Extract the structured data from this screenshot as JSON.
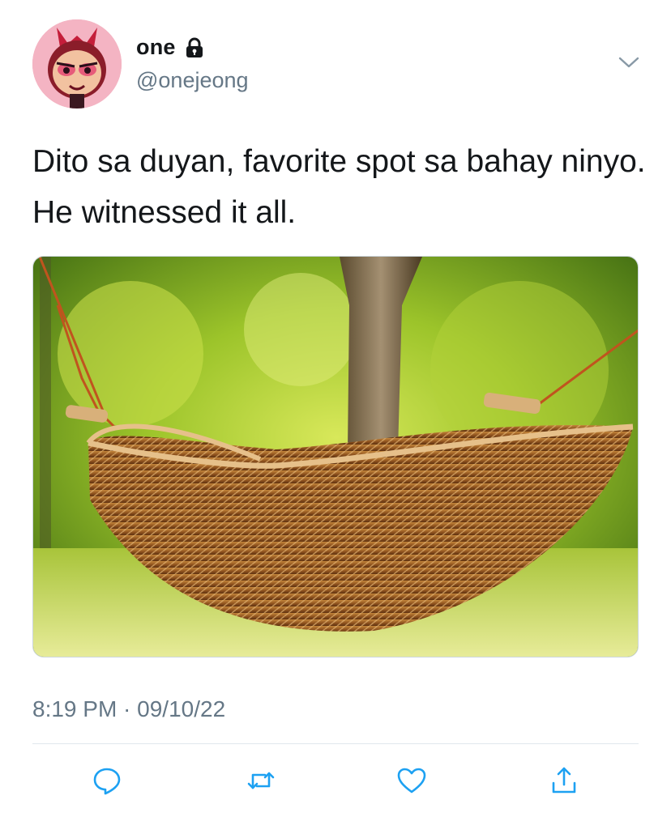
{
  "header": {
    "display_name": "one",
    "handle": "@onejeong",
    "avatar_icon": "powerpuff-avatar",
    "lock_icon": "lock-icon",
    "menu_icon": "chevron-down-icon"
  },
  "tweet": {
    "text": "Dito sa duyan, favorite spot sa bahay ninyo. He witnessed it all.",
    "media_alt": "woven rattan hammock hanging between trees",
    "timestamp": "8:19 PM · 09/10/22"
  },
  "actions": [
    {
      "icon": "reply-icon"
    },
    {
      "icon": "retweet-icon"
    },
    {
      "icon": "like-icon"
    },
    {
      "icon": "share-icon"
    }
  ],
  "colors": {
    "primary_text": "#14171a",
    "secondary_text": "#657786",
    "icon": "#1da1f2",
    "divider": "#e1e8ed"
  }
}
